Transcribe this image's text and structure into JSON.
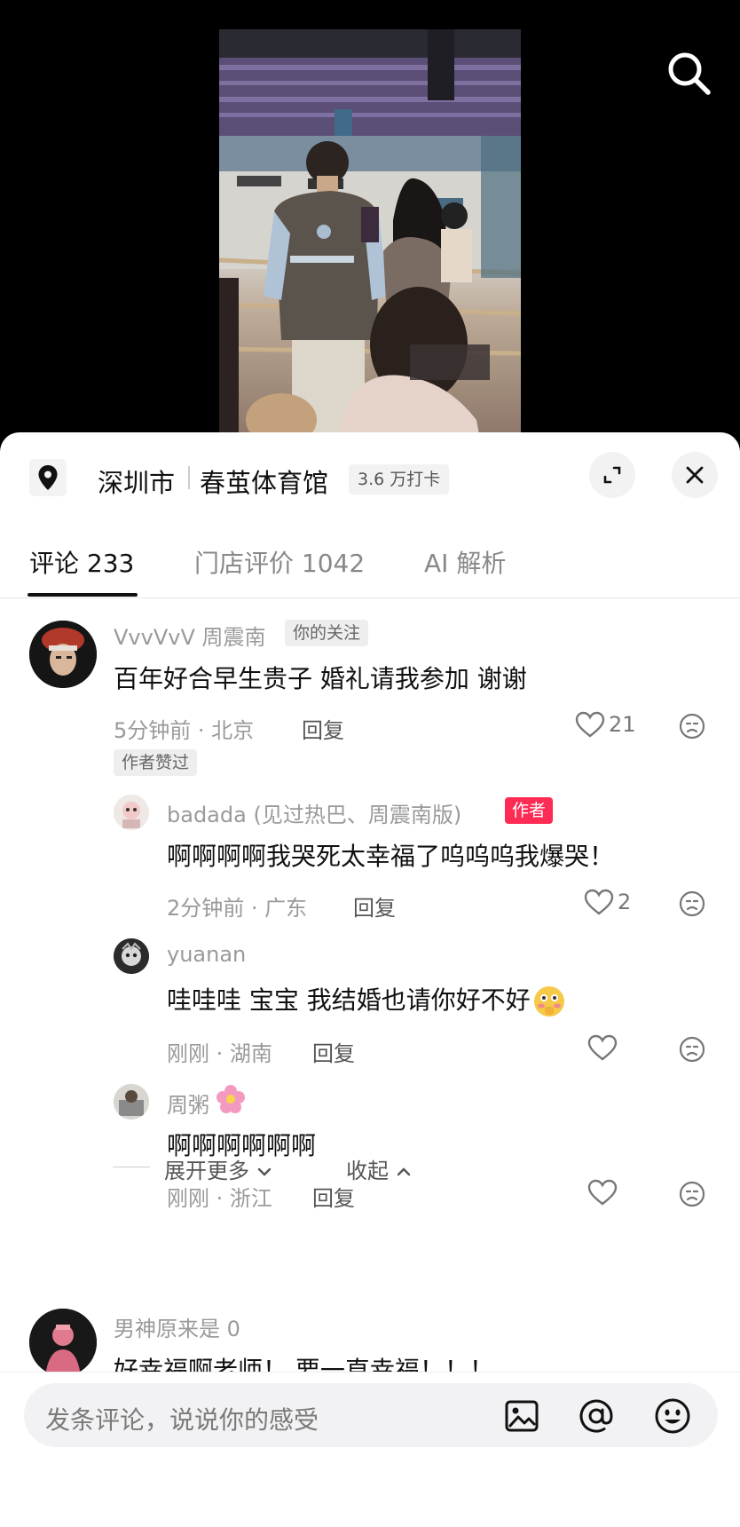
{
  "location": {
    "city": "深圳市",
    "venue": "春茧体育馆",
    "checkins": "3.6 万打卡"
  },
  "tabs": [
    {
      "label": "评论 233"
    },
    {
      "label": "门店评价 1042"
    },
    {
      "label": "AI 解析"
    }
  ],
  "comments": [
    {
      "username": "VvvVvV 周震南",
      "tag": "你的关注",
      "text": "百年好合早生贵子 婚礼请我参加 谢谢",
      "meta": "5分钟前 · 北京",
      "reply": "回复",
      "likes": "21",
      "author_liked": "作者赞过"
    },
    {
      "username": "badada (见过热巴、周震南版)",
      "tag": "作者",
      "text": "啊啊啊啊我哭死太幸福了呜呜呜我爆哭！",
      "meta": "2分钟前 · 广东",
      "reply": "回复",
      "likes": "2"
    },
    {
      "username": "yuanan",
      "text": "哇哇哇 宝宝 我结婚也请你好不好",
      "meta": "刚刚 · 湖南",
      "reply": "回复"
    },
    {
      "username": "周粥",
      "text": "啊啊啊啊啊啊",
      "meta": "刚刚 · 浙江",
      "reply": "回复"
    },
    {
      "username": "男神原来是 0",
      "text": "好幸福啊老师！ 要一直幸福！！！"
    }
  ],
  "thread": {
    "expand_more": "展开更多",
    "collapse": "收起"
  },
  "input": {
    "placeholder": "发条评论，说说你的感受"
  },
  "colors": {
    "accent_red": "#fe2c55",
    "text_primary": "#111111",
    "text_secondary": "#9a9a9a"
  },
  "icons": [
    "search-icon",
    "location-pin-icon",
    "expand-icon",
    "close-icon",
    "heart-icon",
    "dislike-face-icon",
    "chevron-down-icon",
    "chevron-up-icon",
    "image-icon",
    "at-icon",
    "emoji-icon"
  ]
}
